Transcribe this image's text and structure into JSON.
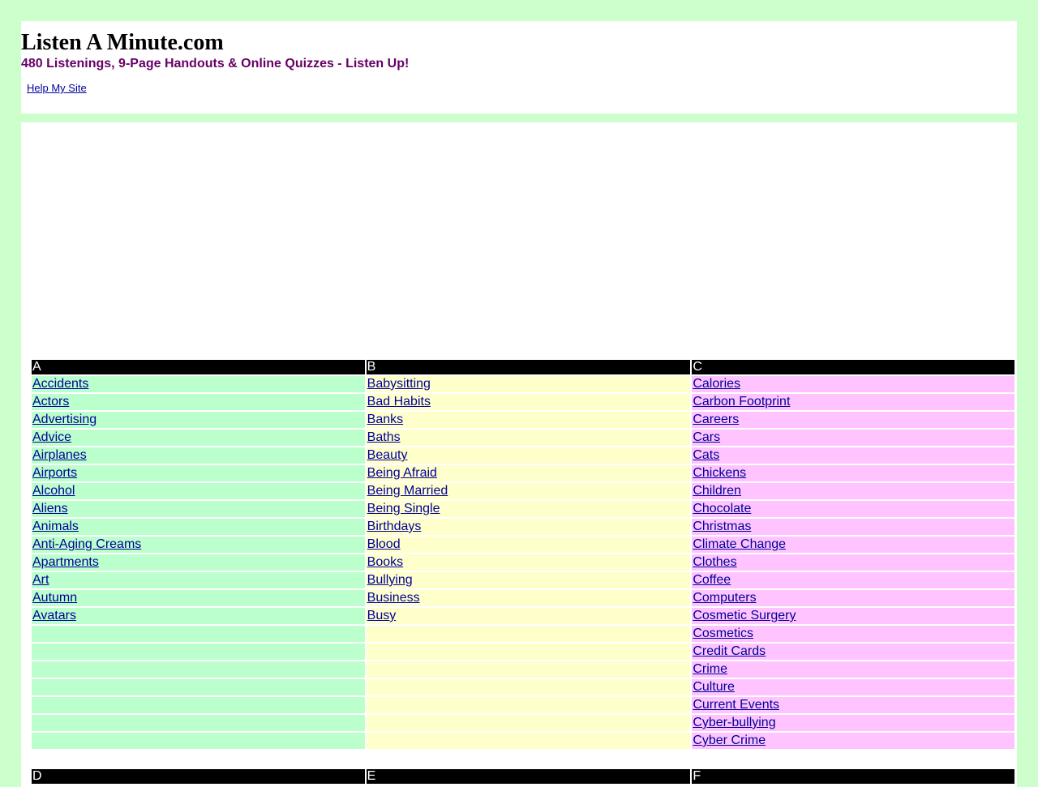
{
  "site": {
    "title": "Listen A Minute.com",
    "tagline": "480 Listenings, 9-Page Handouts & Online Quizzes - Listen Up!",
    "help_link": "Help My Site"
  },
  "colors": {
    "page_bg": "#ccffcc",
    "tagline": "#660066",
    "link": "#000099",
    "header_bg": "#000000",
    "col_a_bg": "#bbffcc",
    "col_b_bg": "#ffffcc",
    "col_c_bg": "#ffc4ff"
  },
  "topics": {
    "headers": [
      "A",
      "B",
      "C"
    ],
    "rows": [
      [
        "Accidents",
        "Babysitting",
        "Calories"
      ],
      [
        "Actors",
        "Bad Habits",
        "Carbon Footprint"
      ],
      [
        "Advertising",
        "Banks",
        "Careers"
      ],
      [
        "Advice",
        "Baths",
        "Cars"
      ],
      [
        "Airplanes",
        "Beauty",
        "Cats"
      ],
      [
        "Airports",
        "Being Afraid",
        "Chickens"
      ],
      [
        "Alcohol",
        "Being Married",
        "Children"
      ],
      [
        "Aliens",
        "Being Single",
        "Chocolate"
      ],
      [
        "Animals",
        "Birthdays",
        "Christmas"
      ],
      [
        "Anti-Aging Creams",
        "Blood",
        "Climate Change"
      ],
      [
        "Apartments",
        "Books",
        "Clothes"
      ],
      [
        "Art",
        "Bullying",
        "Coffee"
      ],
      [
        "Autumn",
        "Business",
        "Computers"
      ],
      [
        "Avatars",
        "Busy",
        "Cosmetic Surgery"
      ],
      [
        "",
        "",
        "Cosmetics"
      ],
      [
        "",
        "",
        "Credit Cards"
      ],
      [
        "",
        "",
        "Crime"
      ],
      [
        "",
        "",
        "Culture"
      ],
      [
        "",
        "",
        "Current Events"
      ],
      [
        "",
        "",
        "Cyber-bullying"
      ],
      [
        "",
        "",
        "Cyber Crime"
      ]
    ],
    "next_headers": [
      "D",
      "E",
      "F"
    ]
  }
}
